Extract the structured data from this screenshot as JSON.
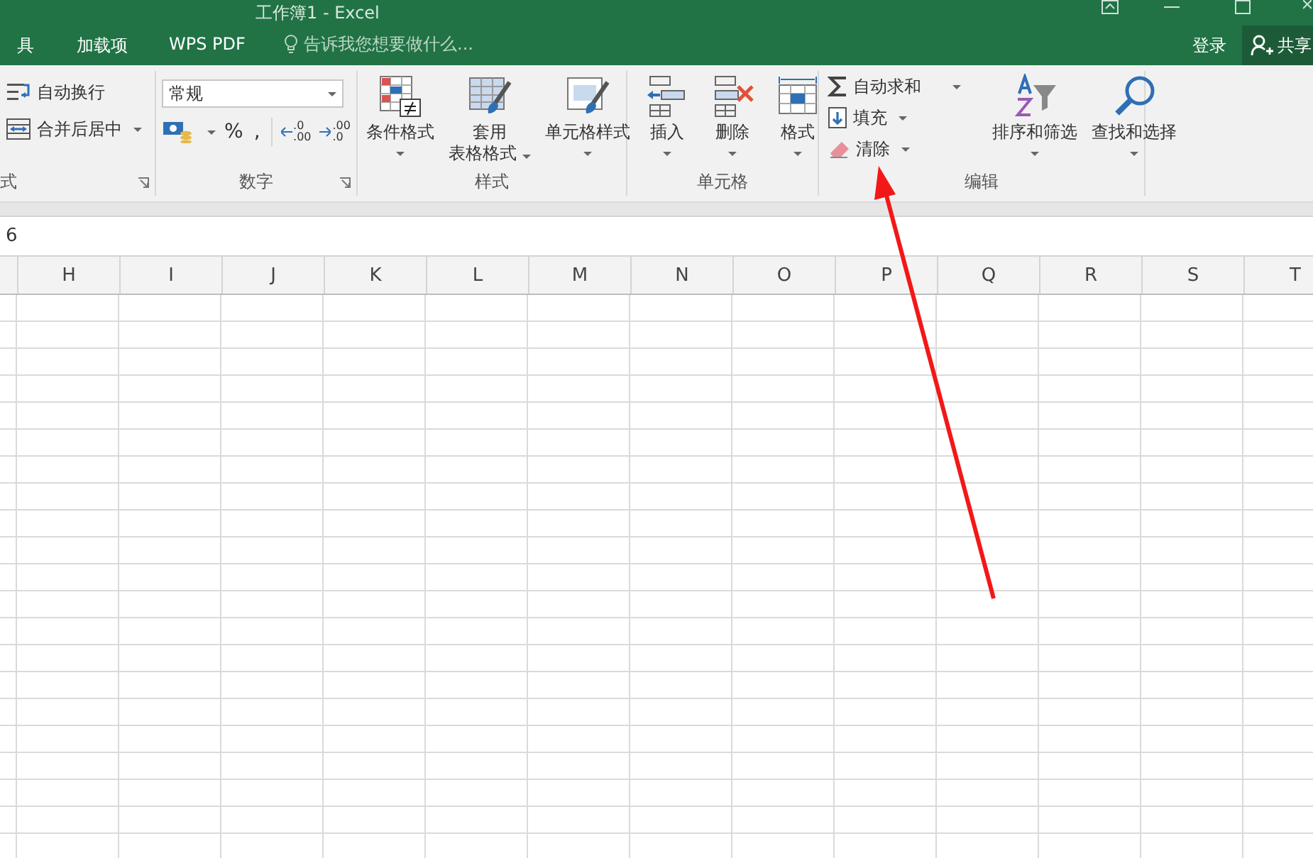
{
  "window": {
    "title": "工作簿1 - Excel"
  },
  "tabs": [
    {
      "label": "具"
    },
    {
      "label": "加载项"
    },
    {
      "label": "WPS PDF"
    }
  ],
  "tell_me": {
    "placeholder": "告诉我您想要做什么..."
  },
  "sign_in": "登录",
  "share": "共享",
  "ribbon": {
    "groups": [
      {
        "label": "式",
        "launcher": true,
        "items": [
          {
            "kind": "small",
            "label": "自动换行",
            "dropdown": false
          },
          {
            "kind": "small",
            "label": "合并后居中",
            "dropdown": true
          }
        ]
      },
      {
        "label": "数字",
        "launcher": true,
        "items": [
          {
            "kind": "format-field",
            "value": "常规"
          },
          {
            "kind": "number-row",
            "symbols": [
              "%",
              ","
            ],
            "decimals": [
              [
                ".0",
                ".00"
              ],
              [
                ".00",
                ".0"
              ]
            ]
          }
        ]
      },
      {
        "label": "样式",
        "launcher": false,
        "items": [
          {
            "kind": "large",
            "lines": [
              "条件格式"
            ],
            "dropdown": true
          },
          {
            "kind": "large",
            "lines": [
              "套用",
              "表格格式"
            ],
            "dropdown": true
          },
          {
            "kind": "large",
            "lines": [
              "单元格样式"
            ],
            "dropdown": true
          }
        ]
      },
      {
        "label": "单元格",
        "launcher": false,
        "items": [
          {
            "kind": "large",
            "lines": [
              "插入"
            ],
            "dropdown": true
          },
          {
            "kind": "large",
            "lines": [
              "删除"
            ],
            "dropdown": true
          },
          {
            "kind": "large",
            "lines": [
              "格式"
            ],
            "dropdown": true
          }
        ]
      },
      {
        "label": "编辑",
        "launcher": false,
        "items": [
          {
            "kind": "stack",
            "entries": [
              {
                "label": "自动求和",
                "dropdown": true
              },
              {
                "label": "填充",
                "dropdown": true
              },
              {
                "label": "清除",
                "dropdown": true
              }
            ]
          },
          {
            "kind": "large",
            "lines": [
              "排序和筛选"
            ],
            "dropdown": true
          },
          {
            "kind": "large",
            "lines": [
              "查找和选择"
            ],
            "dropdown": true
          }
        ]
      }
    ]
  },
  "formula_bar": {
    "value": "6"
  },
  "columns": [
    "H",
    "I",
    "J",
    "K",
    "L",
    "M",
    "N",
    "O",
    "P",
    "Q",
    "R",
    "S",
    "T"
  ]
}
